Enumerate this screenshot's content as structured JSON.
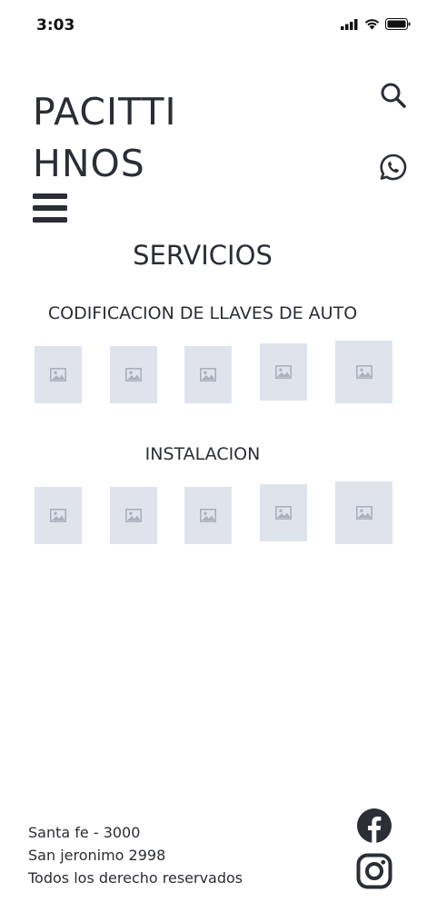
{
  "status_bar": {
    "time": "3:03",
    "signal_icon": "signal-bars-icon",
    "wifi_icon": "wifi-icon",
    "battery_icon": "battery-icon"
  },
  "header": {
    "brand_line1": "PACITTI",
    "brand_line2": "HNOS",
    "search_icon": "search-icon",
    "whatsapp_icon": "whatsapp-icon",
    "menu_icon": "hamburger-menu-icon"
  },
  "main": {
    "title": "SERVICIOS",
    "sections": [
      {
        "title": "CODIFICACION DE LLAVES DE AUTO",
        "image_count": 5,
        "image_icon": "image-placeholder-icon"
      },
      {
        "title": "INSTALACION",
        "image_count": 5,
        "image_icon": "image-placeholder-icon"
      }
    ]
  },
  "footer": {
    "line1": "Santa fe - 3000",
    "line2": "San jeronimo 2998",
    "line3": "Todos los derecho reservados",
    "facebook_icon": "facebook-icon",
    "instagram_icon": "instagram-icon"
  },
  "colors": {
    "text": "#2b2e35",
    "placeholder_bg": "#dfe4ec",
    "placeholder_icon": "#a9b1bd"
  }
}
